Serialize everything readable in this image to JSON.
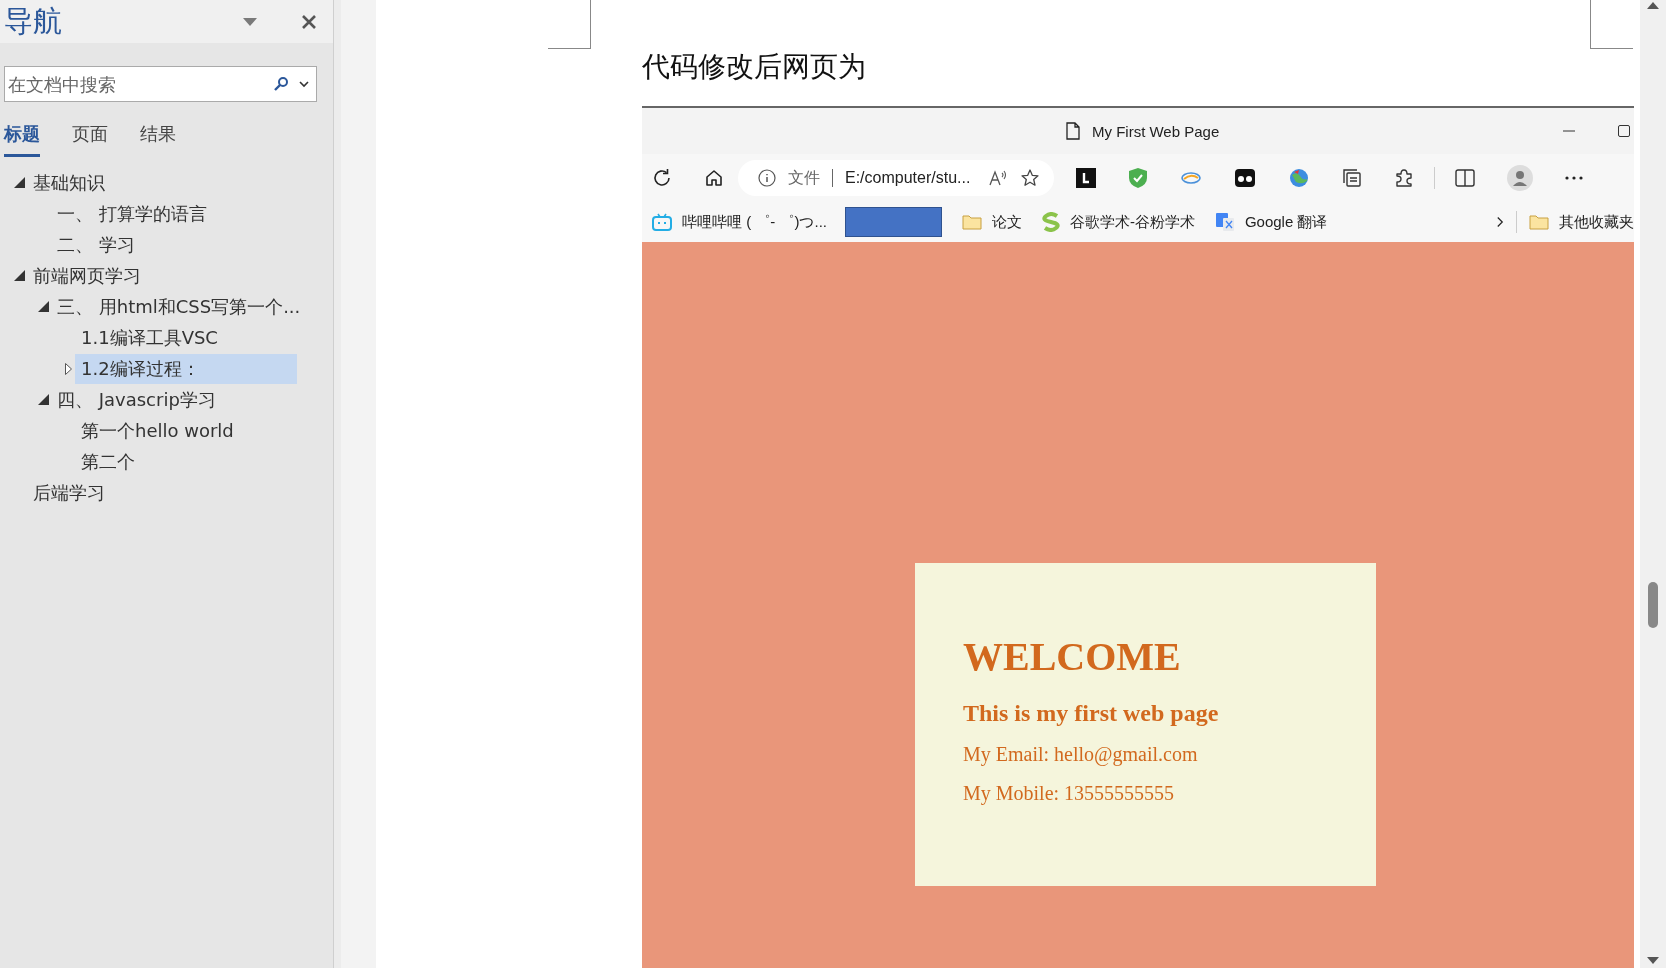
{
  "nav": {
    "title": "导航",
    "search": {
      "placeholder": "在文档中搜索"
    },
    "tabs": [
      {
        "label": "标题",
        "selected": true
      },
      {
        "label": "页面",
        "selected": false
      },
      {
        "label": "结果",
        "selected": false
      }
    ],
    "tree": [
      {
        "label": "基础知识",
        "expanded": true,
        "selected": false,
        "children": [
          {
            "label": "一、 打算学的语言",
            "selected": false
          },
          {
            "label": "二、 学习",
            "selected": false
          }
        ]
      },
      {
        "label": "前端网页学习",
        "expanded": true,
        "selected": false,
        "children": [
          {
            "label": "三、 用html和CSS写第一个...",
            "expanded": true,
            "selected": false,
            "children": [
              {
                "label": "1.1编译工具VSC",
                "selected": false
              },
              {
                "label": "1.2编译过程：",
                "expanded": false,
                "selected": true
              }
            ]
          },
          {
            "label": "四、 Javascrip学习",
            "expanded": true,
            "selected": false,
            "children": [
              {
                "label": "第一个hello world",
                "selected": false
              },
              {
                "label": "第二个",
                "selected": false
              }
            ]
          }
        ]
      },
      {
        "label": "后端学习",
        "selected": false
      }
    ]
  },
  "document": {
    "heading": "代码修改后网页为",
    "browser": {
      "tab_title": "My First Web Page",
      "address": {
        "scheme_label": "文件",
        "url": "E:/computer/stu..."
      },
      "bookmarks": [
        {
          "kind": "bilibili",
          "label": "哔哩哔哩 ( ゜- ゜)つ..."
        },
        {
          "kind": "redacted"
        },
        {
          "kind": "folder",
          "label": "论文"
        },
        {
          "kind": "scholar",
          "label": "谷歌学术-谷粉学术"
        },
        {
          "kind": "translate",
          "label": "Google 翻译"
        }
      ],
      "other_bookmarks": "其他收藏夹",
      "page": {
        "title": "WELCOME",
        "subtitle": "This is my first web page",
        "lines": [
          "My Email: hello@gmail.com",
          "My Mobile: 13555555555"
        ]
      }
    }
  }
}
